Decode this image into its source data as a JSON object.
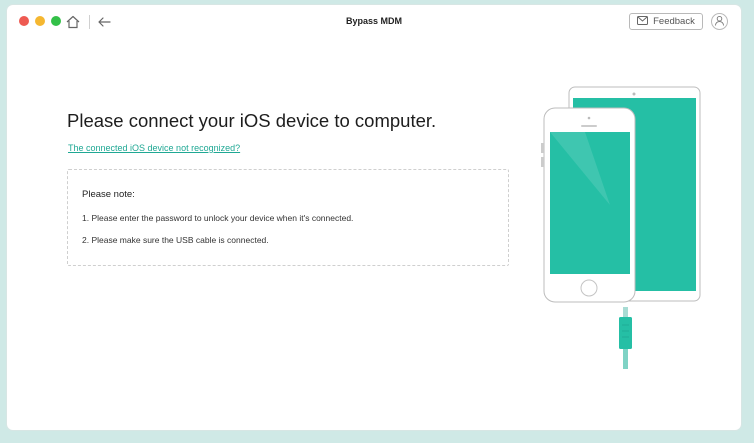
{
  "app": {
    "title": "Bypass MDM"
  },
  "toolbar": {
    "feedback_label": "Feedback",
    "icons": [
      "home-icon",
      "back-arrow-icon",
      "mail-icon",
      "user-icon"
    ]
  },
  "main": {
    "heading": "Please connect your iOS device to computer.",
    "help_link": "The connected iOS device not recognized?",
    "note": {
      "title": "Please note:",
      "items": [
        "1. Please enter the password to unlock your device when it's connected.",
        "2. Please make sure the USB cable is connected."
      ]
    }
  },
  "colors": {
    "accent": "#1fa894",
    "screen": "#25bfa5",
    "background": "#cfe9e6"
  }
}
